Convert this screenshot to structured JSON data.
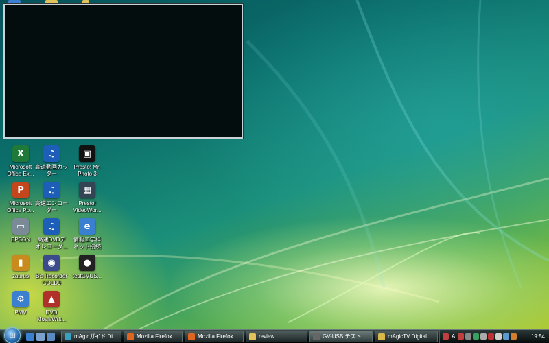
{
  "desktop": {
    "icons": [
      {
        "label": "Microsoft\nOffice Ex...",
        "icon": "excel-icon",
        "color": "#1f7a3a",
        "glyph": "X"
      },
      {
        "label": "高速動画カッ\nター",
        "icon": "video-cutter-icon",
        "color": "#1d5fb8",
        "glyph": "♫"
      },
      {
        "label": "Presto! Mr.\nPhoto 3",
        "icon": "mr-photo-icon",
        "color": "#111111",
        "glyph": "▣"
      },
      {
        "label": "Microsoft\nOffice Po...",
        "icon": "powerpoint-icon",
        "color": "#c4461d",
        "glyph": "P"
      },
      {
        "label": "高速エンコー\nダー",
        "icon": "encoder-icon",
        "color": "#1d5fb8",
        "glyph": "♫"
      },
      {
        "label": "Presto!\nVideoWor...",
        "icon": "videoworks-icon",
        "color": "#345",
        "glyph": "▦"
      },
      {
        "label": "EPSON",
        "icon": "printer-icon",
        "color": "#7a8a96",
        "glyph": "▭"
      },
      {
        "label": "高速DVDデ\nオレコーダ...",
        "icon": "dvd-recorder-icon",
        "color": "#1d5fb8",
        "glyph": "♫"
      },
      {
        "label": "情報エ学科\nネット接続",
        "icon": "network-shortcut-icon",
        "color": "#3a7fd0",
        "glyph": "e"
      },
      {
        "label": "zaurus",
        "icon": "zaurus-icon",
        "color": "#c98b1e",
        "glyph": "▮"
      },
      {
        "label": "B's Recorder\nGOLD9",
        "icon": "bs-recorder-icon",
        "color": "#3b4a8a",
        "glyph": "◉"
      },
      {
        "label": "testGVUS...",
        "icon": "test-gvusb-icon",
        "color": "#222222",
        "glyph": "●"
      },
      {
        "label": "PMV",
        "icon": "pmv-icon",
        "color": "#3a7fd0",
        "glyph": "⚙"
      },
      {
        "label": "DVD\nMovieWrit...",
        "icon": "dvd-moviewriter-icon",
        "color": "#b0302a",
        "glyph": "▲"
      }
    ]
  },
  "taskbar": {
    "buttons": [
      {
        "label": "mAgicガイド Di...",
        "icon": "magic-guide-icon",
        "color": "#3aa0c0",
        "active": false
      },
      {
        "label": "Mozilla Firefox",
        "icon": "firefox-icon",
        "color": "#e0651f",
        "active": false
      },
      {
        "label": "Mozilla Firefox",
        "icon": "firefox-icon",
        "color": "#e0651f",
        "active": false
      },
      {
        "label": "review",
        "icon": "folder-icon",
        "color": "#e2c25a",
        "active": false
      },
      {
        "label": "GV-USB テスト...",
        "icon": "gv-usb-icon",
        "color": "#666666",
        "active": true
      },
      {
        "label": "mAgicTV Digital",
        "icon": "magictv-icon",
        "color": "#d8b84a",
        "active": false
      }
    ],
    "quick_launch": [
      {
        "icon": "ie-icon",
        "color": "#3a7fd0"
      },
      {
        "icon": "show-desktop-icon",
        "color": "#7aa0d0"
      },
      {
        "icon": "switch-windows-icon",
        "color": "#5a8ac0"
      }
    ],
    "tray": {
      "ime_label": "A",
      "clock": "19:54",
      "icons": [
        {
          "icon": "ime-icon",
          "color": "#c04040"
        },
        {
          "icon": "chevron-left-icon",
          "color": "#888888"
        },
        {
          "icon": "network-icon",
          "color": "#3aa060"
        },
        {
          "icon": "volume-icon",
          "color": "#aaaaaa"
        },
        {
          "icon": "security-icon",
          "color": "#c03030"
        },
        {
          "icon": "battery-icon",
          "color": "#d0d0d0"
        },
        {
          "icon": "update-icon",
          "color": "#5a9ad0"
        },
        {
          "icon": "tv-tuner-icon",
          "color": "#d08030"
        }
      ]
    }
  }
}
